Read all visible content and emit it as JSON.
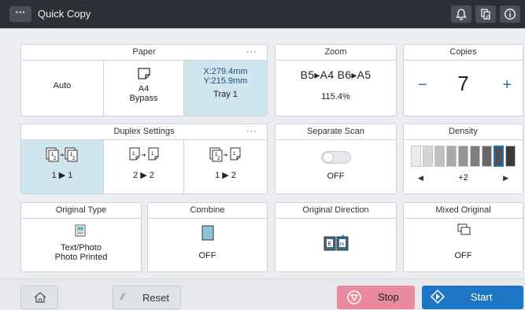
{
  "app": {
    "title": "Quick Copy",
    "menu_label": "···"
  },
  "topbar_icons": [
    "bell-icon",
    "copy-job-icon",
    "info-icon"
  ],
  "paper": {
    "title": "Paper",
    "more": "···",
    "auto": "Auto",
    "bypass_size": "A4",
    "bypass_label": "Bypass",
    "tray_x": "X:279.4mm",
    "tray_y": "Y:215.9mm",
    "tray_label": "Tray 1"
  },
  "zoom": {
    "title": "Zoom",
    "preset": "B5▸A4  B6▸A5",
    "value": "115.4%"
  },
  "copies": {
    "title": "Copies",
    "minus": "−",
    "value": "7",
    "plus": "+"
  },
  "duplex": {
    "title": "Duplex Settings",
    "more": "···",
    "options": [
      {
        "label": "1 ▶ 1",
        "selected": true
      },
      {
        "label": "2 ▶ 2",
        "selected": false
      },
      {
        "label": "1 ▶ 2",
        "selected": false
      }
    ]
  },
  "separate_scan": {
    "title": "Separate Scan",
    "state": "OFF"
  },
  "density": {
    "title": "Density",
    "value": "+2",
    "level_index": 7,
    "levels": 9,
    "left_arrow": "◀",
    "right_arrow": "▶"
  },
  "original_type": {
    "title": "Original Type",
    "line1": "Text/Photo",
    "line2": "Photo Printed"
  },
  "combine": {
    "title": "Combine",
    "state": "OFF"
  },
  "original_direction": {
    "title": "Original Direction"
  },
  "mixed_original": {
    "title": "Mixed Original",
    "state": "OFF"
  },
  "bottom": {
    "reset": "Reset",
    "stop": "Stop",
    "start": "Start"
  },
  "colors": {
    "accent_blue": "#1f73b7",
    "selected_bg": "#cfe6ee",
    "stop_pink": "#e98a9e",
    "start_blue": "#1d76c4",
    "titlebar": "#2b2f36"
  }
}
